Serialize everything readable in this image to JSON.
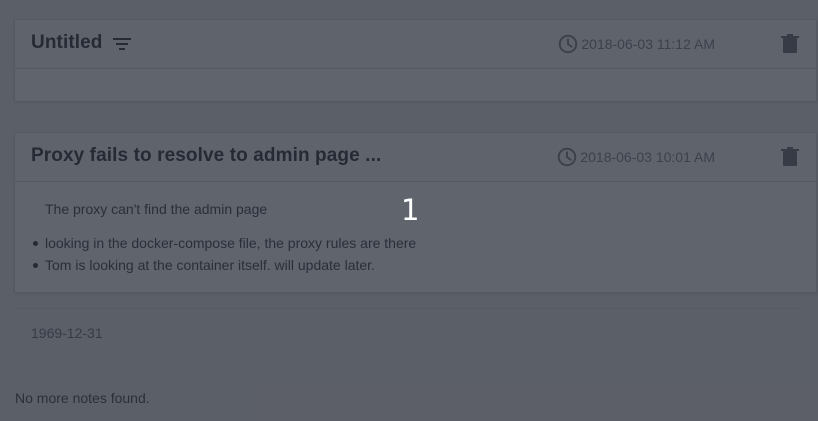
{
  "notes": [
    {
      "title": "Untitled",
      "timestamp": "2018-06-03 11:12 AM",
      "body_text": "",
      "bullets": []
    },
    {
      "title": "Proxy fails to resolve to admin page ...",
      "timestamp": "2018-06-03 10:01 AM",
      "body_text": "The proxy can't find the admin page",
      "bullets": [
        "looking in the docker-compose file, the proxy rules are there",
        "Tom is looking at the container itself. will update later."
      ]
    }
  ],
  "date_group": "1969-12-31",
  "footer": {
    "message": "No more notes found."
  },
  "overlay": {
    "label": "1"
  },
  "icons": {
    "filter": "filter-icon",
    "clock": "clock-icon",
    "trash": "trash-icon"
  },
  "colors": {
    "overlay": "#232834",
    "title": "#2f3033",
    "muted": "#7f8087"
  }
}
